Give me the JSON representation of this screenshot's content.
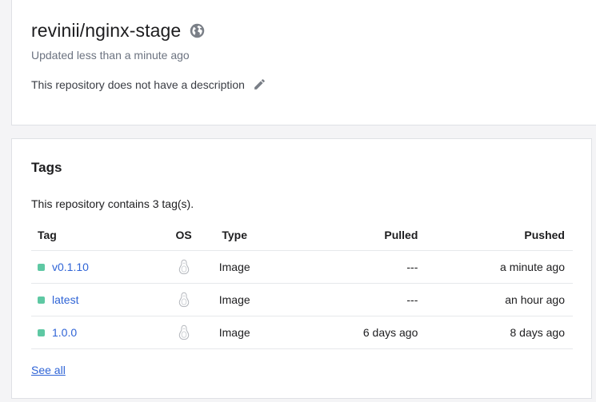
{
  "repo": {
    "name": "revinii/nginx-stage",
    "updated": "Updated less than a minute ago",
    "description": "This repository does not have a description",
    "visibility_icon": "globe-icon",
    "edit_icon": "pencil-icon"
  },
  "tags": {
    "title": "Tags",
    "count_text": "This repository contains 3 tag(s).",
    "columns": {
      "tag": "Tag",
      "os": "OS",
      "type": "Type",
      "pulled": "Pulled",
      "pushed": "Pushed"
    },
    "rows": [
      {
        "tag": "v0.1.10",
        "os_icon": "linux-icon",
        "type": "Image",
        "pulled": "---",
        "pushed": "a minute ago"
      },
      {
        "tag": "latest",
        "os_icon": "linux-icon",
        "type": "Image",
        "pulled": "---",
        "pushed": "an hour ago"
      },
      {
        "tag": "1.0.0",
        "os_icon": "linux-icon",
        "type": "Image",
        "pulled": "6 days ago",
        "pushed": "8 days ago"
      }
    ],
    "see_all": "See all"
  },
  "colors": {
    "link": "#2f64d6",
    "status_dot": "#5ec8a3",
    "muted_text": "#6c7380",
    "icon_gray": "#7a7f87"
  }
}
